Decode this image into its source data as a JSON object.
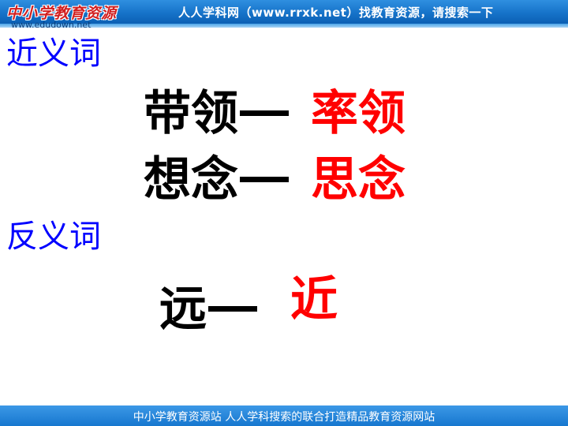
{
  "header": {
    "logo_text": "中小学教育资源",
    "logo_url": "www.edudown.net",
    "banner_text": "人人学科网（www.rrxk.net）找教育资源，请搜索一下"
  },
  "synonyms": {
    "label": "近义词",
    "pairs": [
      {
        "word": "带领",
        "match": "率领"
      },
      {
        "word": "想念",
        "match": "思念"
      }
    ]
  },
  "antonyms": {
    "label": "反义词",
    "pairs": [
      {
        "word": "远",
        "match": "近"
      }
    ]
  },
  "footer": {
    "text": "中小学教育资源站 人人学科搜索的联合打造精品教育资源网站"
  },
  "colors": {
    "label_blue": "#0000ff",
    "answer_red": "#ff0000",
    "banner_blue": "#1673c9"
  }
}
